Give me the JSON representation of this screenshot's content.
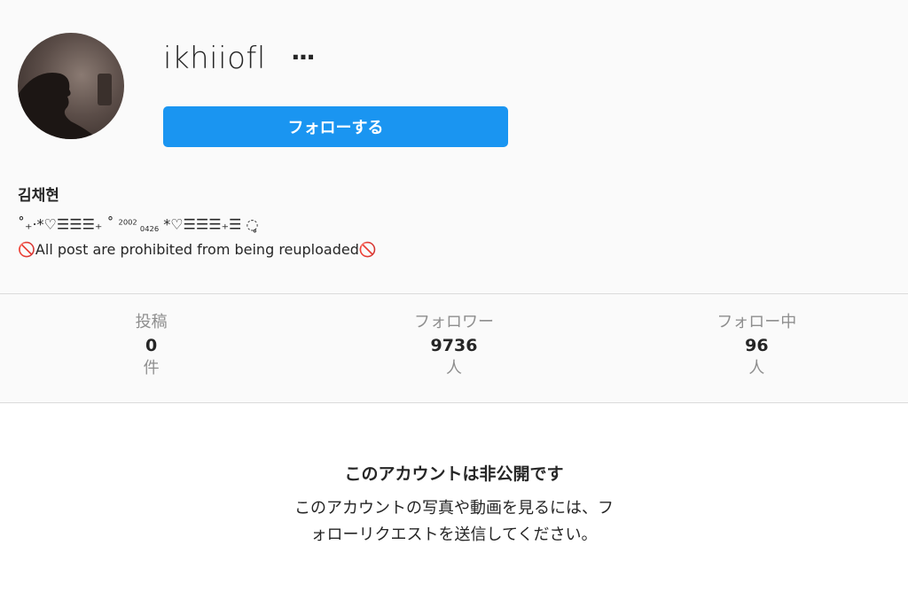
{
  "profile": {
    "username": "ikhiiofl",
    "more_label": "···",
    "follow_label": "フォローする",
    "full_name": "김채현",
    "bio_line1_a": "˚₊·*♡☰☰☰₊ ˚ ",
    "bio_line1_b": "2002",
    "bio_line1_c": "0426",
    "bio_line1_d": " *♡☰☰☰₊☰ ◌̥",
    "ban_icon": "🚫",
    "bio_line2": "All post are prohibited from being reuploaded"
  },
  "stats": [
    {
      "label": "投稿",
      "value": "0",
      "unit": "件"
    },
    {
      "label": "フォロワー",
      "value": "9736",
      "unit": "人"
    },
    {
      "label": "フォロー中",
      "value": "96",
      "unit": "人"
    }
  ],
  "private": {
    "title": "このアカウントは非公開です",
    "message": "このアカウントの写真や動画を見るには、フォローリクエストを送信してください。"
  },
  "colors": {
    "accent": "#1a95f1",
    "background": "#fafafa",
    "border": "#dbdbdb"
  }
}
